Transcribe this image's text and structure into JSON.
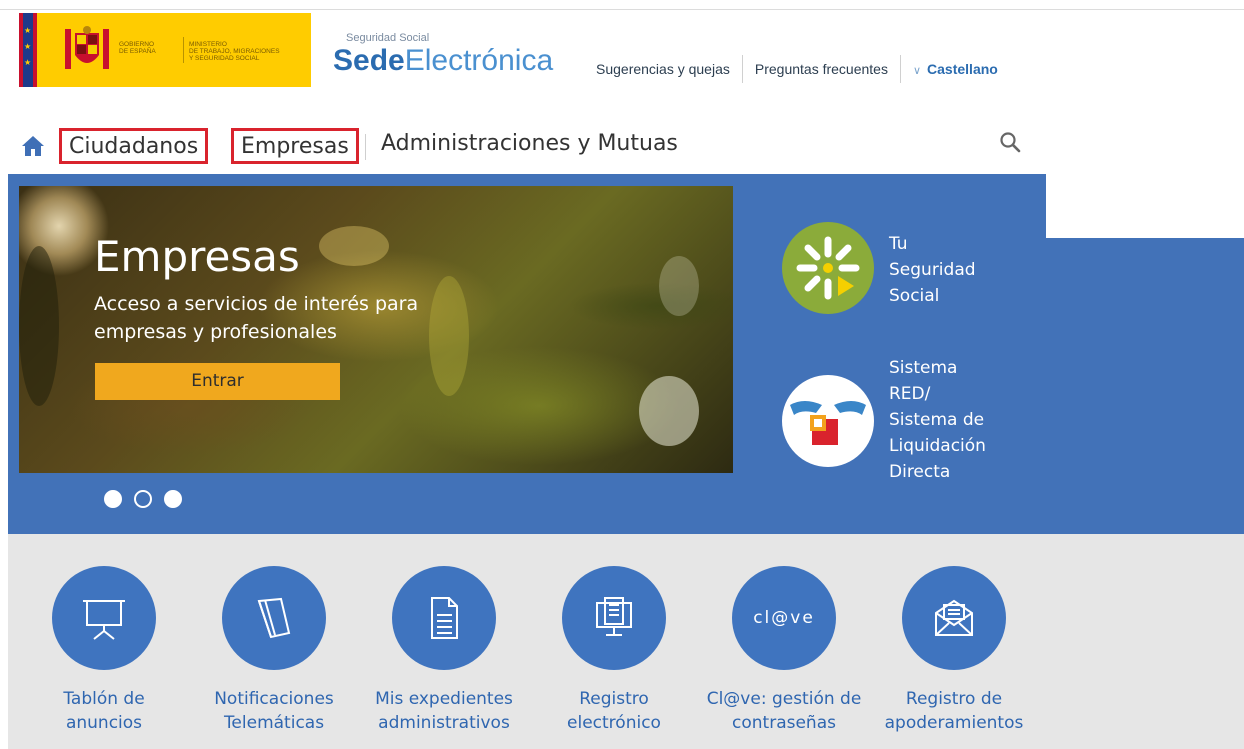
{
  "header": {
    "gov_line1": "GOBIERNO\nDE ESPAÑA",
    "ministry": "MINISTERIO\nDE TRABAJO, MIGRACIONES\nY SEGURIDAD SOCIAL",
    "sede_small": "Seguridad Social",
    "sede_bold": "Sede",
    "sede_light": "Electrónica",
    "links": [
      "Sugerencias y quejas",
      "Preguntas frecuentes"
    ],
    "language": "Castellano"
  },
  "nav": {
    "items": [
      "Ciudadanos",
      "Empresas",
      "Administraciones y Mutuas"
    ]
  },
  "banner": {
    "title": "Empresas",
    "subtitle": "Acceso a servicios de interés para empresas y profesionales",
    "button": "Entrar",
    "slides_total": 3,
    "slide_active": 2
  },
  "side": [
    {
      "label_lines": [
        "Tu",
        "Seguridad",
        "Social"
      ]
    },
    {
      "label_lines": [
        "Sistema",
        "RED/",
        "Sistema de",
        "Liquidación",
        "Directa"
      ]
    }
  ],
  "services": [
    {
      "label": "Tablón de\nanuncios",
      "icon": "presentation-board-icon"
    },
    {
      "label": "Notificaciones\nTelemáticas",
      "icon": "notification-pages-icon"
    },
    {
      "label": "Mis expedientes\nadministrativos",
      "icon": "document-icon"
    },
    {
      "label": "Registro\nelectrónico",
      "icon": "computer-document-icon"
    },
    {
      "label": "Cl@ve: gestión de\ncontraseñas",
      "icon": "clave-logo-icon",
      "icon_text": "cl@ve"
    },
    {
      "label": "Registro de\napoderamientos",
      "icon": "envelope-icon"
    }
  ],
  "colors": {
    "brand_blue": "#4272b8",
    "highlight_red": "#d9232d",
    "button_orange": "#f0a81e",
    "link_blue": "#2f66b0"
  }
}
